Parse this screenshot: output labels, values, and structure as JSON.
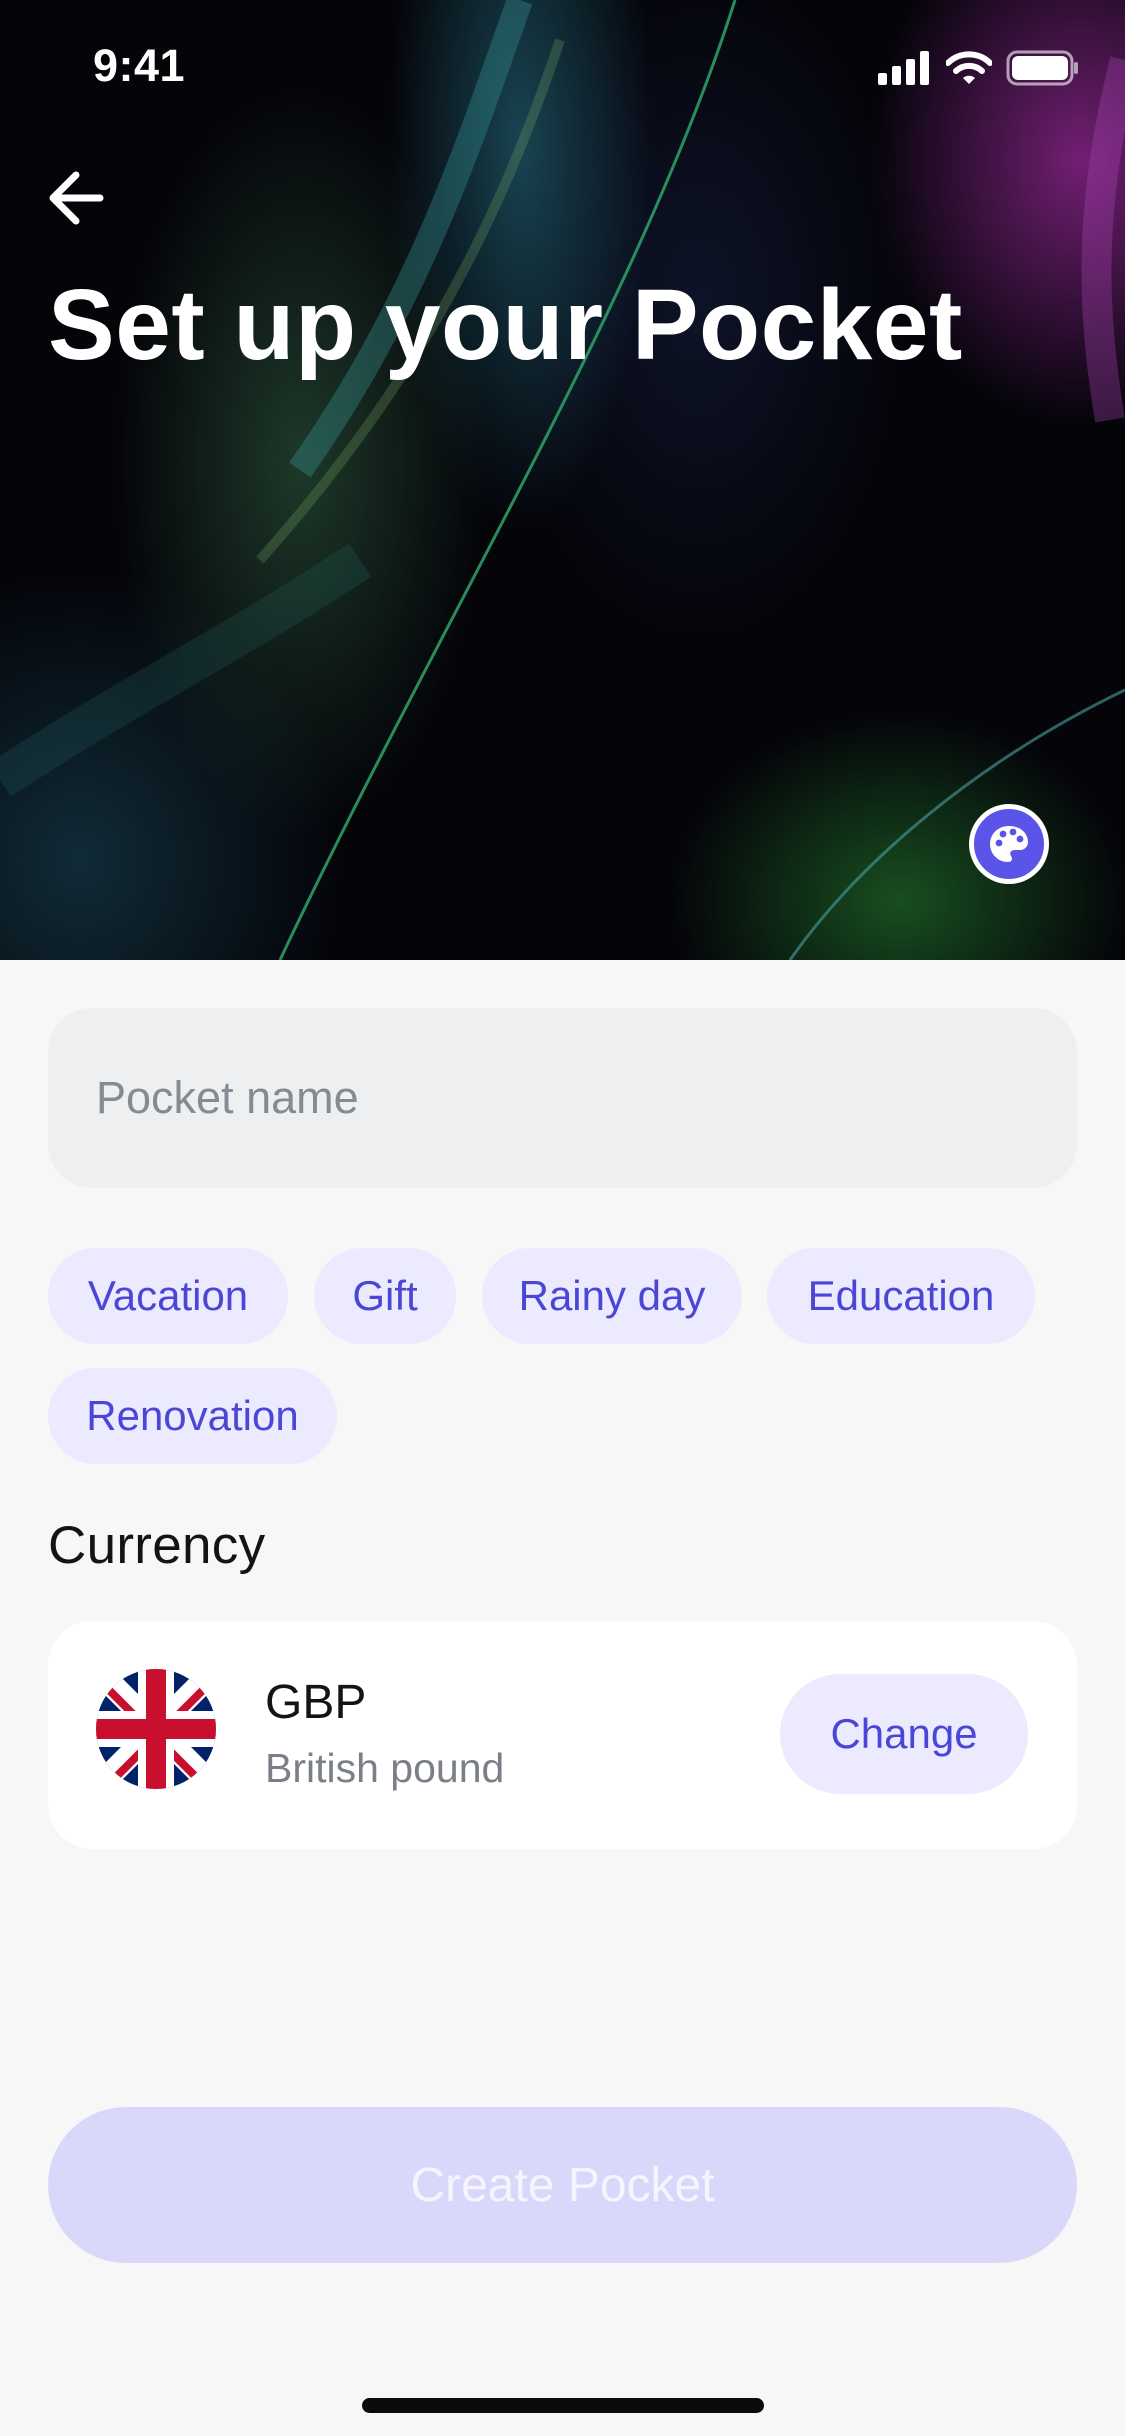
{
  "status_bar": {
    "time": "9:41",
    "signal_icon": "cellular-signal-icon",
    "wifi_icon": "wifi-icon",
    "battery_icon": "battery-icon"
  },
  "header": {
    "back_icon": "arrow-left-icon",
    "title": "Set up your Pocket",
    "theme_icon": "palette-icon"
  },
  "form": {
    "name_placeholder": "Pocket name",
    "name_value": "",
    "suggestions": [
      "Vacation",
      "Gift",
      "Rainy day",
      "Education",
      "Renovation"
    ]
  },
  "currency": {
    "section_label": "Currency",
    "code": "GBP",
    "name": "British pound",
    "flag_icon": "uk-flag-icon",
    "change_label": "Change"
  },
  "actions": {
    "create_label": "Create Pocket",
    "create_enabled": false
  },
  "colors": {
    "accent": "#4b47d6",
    "chip_bg": "#eceaff",
    "disabled_button": "#d9d8fb",
    "background": "#f7f7f7"
  }
}
